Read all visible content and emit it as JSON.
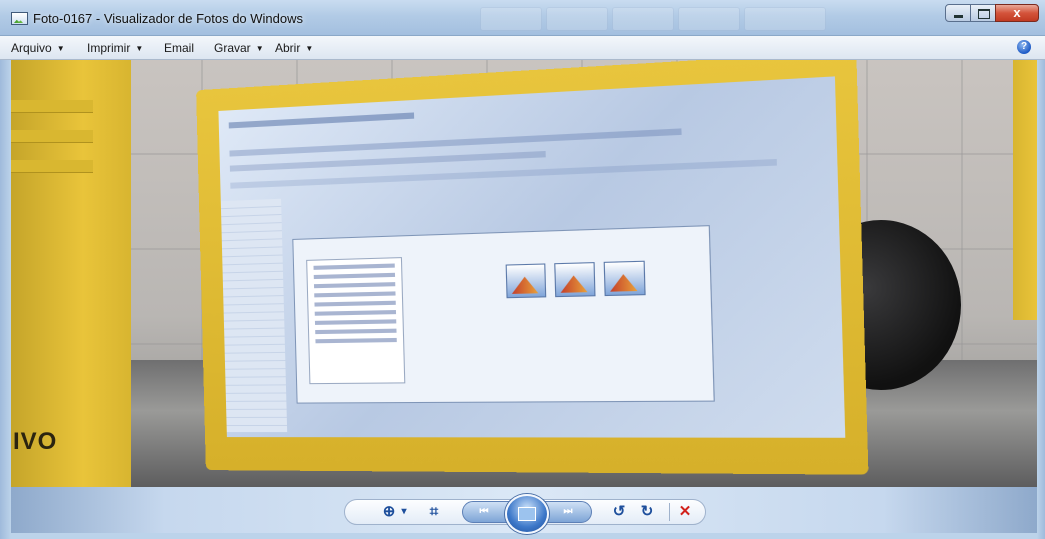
{
  "window": {
    "title": "Foto-0167 - Visualizador de Fotos do Windows",
    "close_glyph": "x"
  },
  "menu": {
    "items": [
      {
        "label": "Arquivo",
        "has_caret": true
      },
      {
        "label": "Imprimir",
        "has_caret": true
      },
      {
        "label": "Email",
        "has_caret": false
      },
      {
        "label": "Gravar",
        "has_caret": true
      },
      {
        "label": "Abrir",
        "has_caret": true
      }
    ],
    "help_glyph": "?"
  },
  "photo": {
    "brand_text": "IVO"
  },
  "controls": {
    "zoom_glyph": "⊕",
    "zoom_caret": "▾",
    "fit_glyph": "⌗",
    "prev_glyph": "⏮",
    "next_glyph": "⏭",
    "rotate_ccw_glyph": "↺",
    "rotate_cw_glyph": "↻",
    "delete_glyph": "✕"
  },
  "colors": {
    "accent": "#1e4f9c",
    "delete": "#d2211b",
    "close_button": "#c13a22"
  }
}
